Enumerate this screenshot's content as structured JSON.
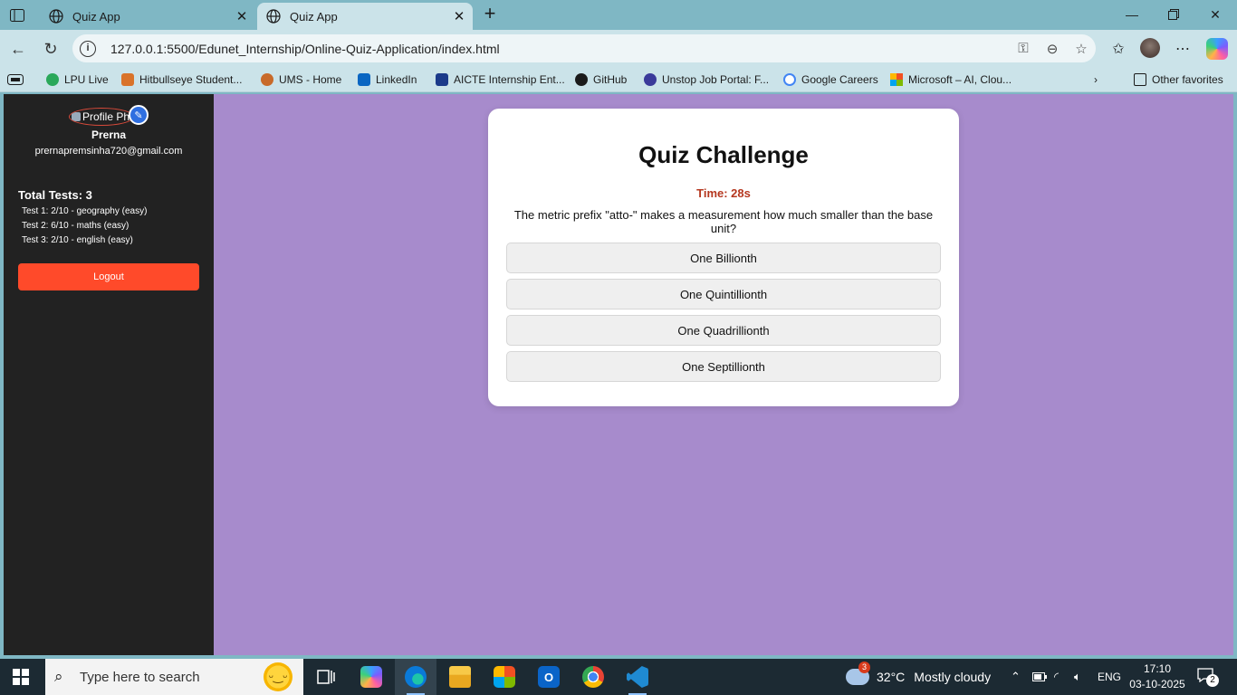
{
  "browser": {
    "tabs": [
      {
        "title": "Quiz App",
        "active": false
      },
      {
        "title": "Quiz App",
        "active": true
      }
    ],
    "url": "127.0.0.1:5500/Edunet_Internship/Online-Quiz-Application/index.html",
    "favorites": [
      {
        "label": "LPU Live",
        "icon": "lpu-icon",
        "color": "#2aa85a"
      },
      {
        "label": "Hitbullseye Student...",
        "icon": "hitbullseye-icon",
        "color": "#d9732a"
      },
      {
        "label": "UMS - Home",
        "icon": "ums-icon",
        "color": "#c86a2a"
      },
      {
        "label": "LinkedIn",
        "icon": "linkedin-icon",
        "color": "#0a66c2"
      },
      {
        "label": "AICTE Internship Ent...",
        "icon": "aicte-icon",
        "color": "#1b3a8a"
      },
      {
        "label": "GitHub",
        "icon": "github-icon",
        "color": "#1b1b1b"
      },
      {
        "label": "Unstop Job Portal: F...",
        "icon": "unstop-icon",
        "color": "#3a3a9a"
      },
      {
        "label": "Google Careers",
        "icon": "google-icon",
        "color": "#4285f4"
      },
      {
        "label": "Microsoft – AI, Clou...",
        "icon": "microsoft-icon",
        "color": "#f25022"
      }
    ],
    "other_favorites": "Other favorites"
  },
  "sidebar": {
    "profile_alt": "Profile Ph",
    "name": "Prerna",
    "email": "prernapremsinha720@gmail.com",
    "total_tests": "Total Tests: 3",
    "tests": [
      "Test 1: 2/10 - geography (easy)",
      "Test 2: 6/10 - maths (easy)",
      "Test 3: 2/10 - english (easy)"
    ],
    "logout": "Logout"
  },
  "quiz": {
    "title": "Quiz Challenge",
    "timer": "Time: 28s",
    "question": "The metric prefix \"atto-\" makes a measurement how much smaller than the base unit?",
    "options": [
      "One Billionth",
      "One Quintillionth",
      "One Quadrillionth",
      "One Septillionth"
    ]
  },
  "taskbar": {
    "search_placeholder": "Type here to search",
    "weather_temp": "32°C",
    "weather_desc": "Mostly cloudy",
    "weather_badge": "3",
    "language": "ENG",
    "time": "17:10",
    "date": "03-10-2025",
    "notifications": "2"
  },
  "colors": {
    "page_bg": "#a78bcc",
    "sidebar_bg": "#222222",
    "logout_bg": "#ff4a2a",
    "timer_color": "#b5371f",
    "browser_frame": "#7fb7c4"
  }
}
